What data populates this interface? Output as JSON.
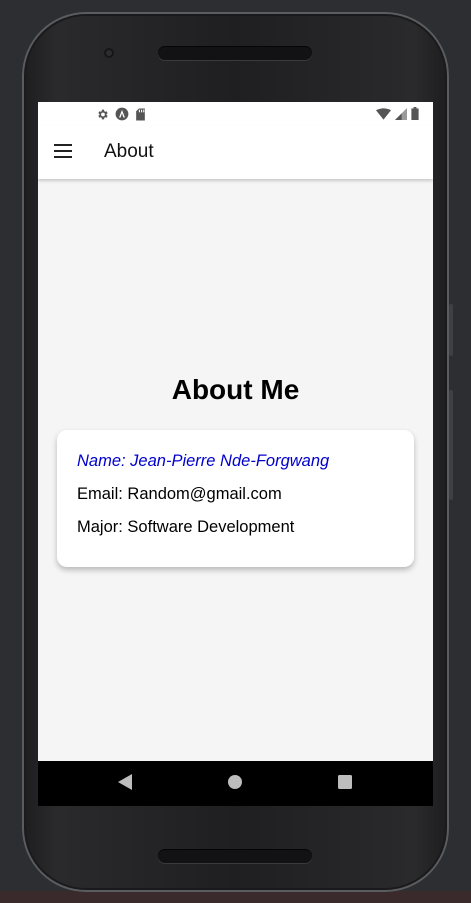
{
  "appbar": {
    "title": "About"
  },
  "page": {
    "heading": "About Me"
  },
  "profile": {
    "name": "Name: Jean-Pierre Nde-Forgwang",
    "email": "Email: Random@gmail.com",
    "major": "Major: Software Development"
  },
  "icons": {
    "status_left": [
      "settings-icon",
      "android-studio-icon",
      "sd-card-icon"
    ],
    "status_right": [
      "wifi-icon",
      "cell-signal-icon",
      "battery-icon"
    ],
    "appbar": "menu-icon",
    "nav": [
      "back-icon",
      "home-icon",
      "recents-icon"
    ]
  },
  "colors": {
    "name_text": "#0000cc",
    "appbar_bg": "#ffffff",
    "screen_bg": "#f5f5f5",
    "navbar_bg": "#000000"
  }
}
